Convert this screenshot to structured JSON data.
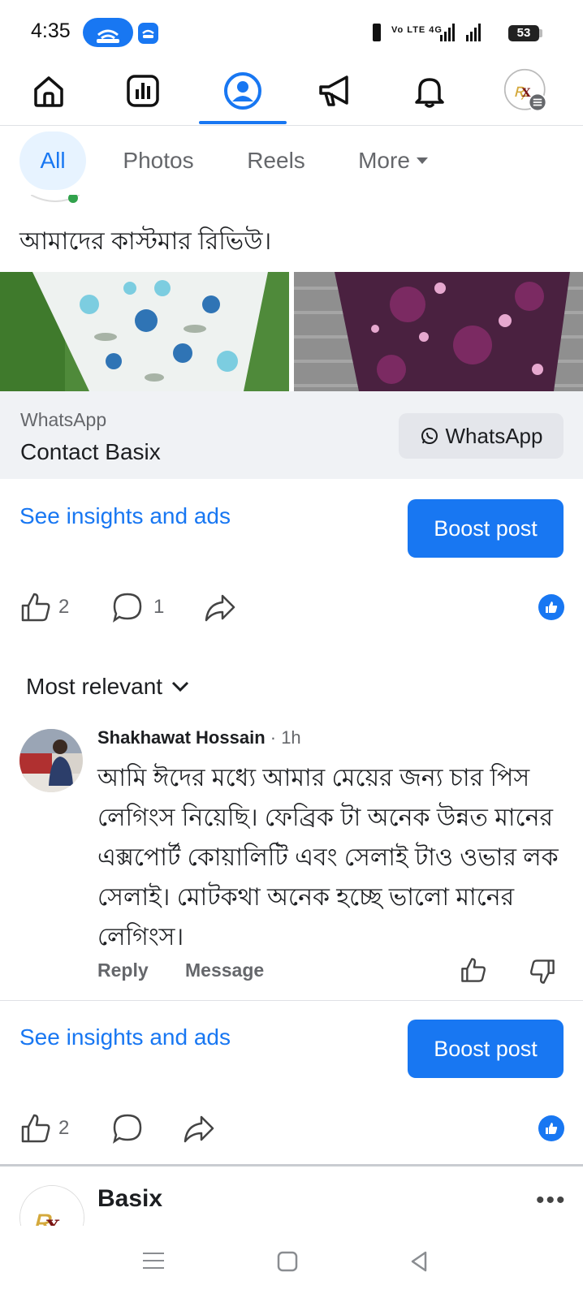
{
  "status_bar": {
    "time": "4:35",
    "network": "Vo LTE 4G",
    "battery": "53"
  },
  "nav": {
    "items": [
      {
        "icon": "home-icon"
      },
      {
        "icon": "insights-icon"
      },
      {
        "icon": "profile-icon",
        "active": true
      },
      {
        "icon": "megaphone-icon"
      },
      {
        "icon": "bell-icon"
      },
      {
        "icon": "page-avatar-icon"
      }
    ],
    "accent": "#1877f2"
  },
  "filters": {
    "all": "All",
    "photos": "Photos",
    "reels": "Reels",
    "more": "More"
  },
  "post1": {
    "caption": "আমাদের কাস্টমার রিভিউ।",
    "whatsapp_label": "WhatsApp",
    "whatsapp_cta_title": "Contact Basix",
    "whatsapp_button": "WhatsApp",
    "insights_link": "See insights and ads",
    "boost_button": "Boost post",
    "like_count": "2",
    "comment_count": "1"
  },
  "comments": {
    "sort_label": "Most relevant",
    "items": [
      {
        "author": "Shakhawat Hossain",
        "time": " · 1h",
        "text": "আমি ঈদের মধ্যে আমার মেয়ের জন্য চার পিস লেগিংস নিয়েছি। ফেব্রিক টা অনেক উন্নত মানের এক্সপোর্ট কোয়ালিটি এবং সেলাই টাও ওভার লক সেলাই। মোটকথা অনেক  হচ্ছে ভালো মানের লেগিংস।",
        "reply": "Reply",
        "message": "Message"
      }
    ]
  },
  "post2": {
    "insights_link": "See insights and ads",
    "boost_button": "Boost post",
    "like_count": "2"
  },
  "post3": {
    "page_name": "Basix"
  },
  "colors": {
    "primary": "#1877f2",
    "secondary_text": "#65676b",
    "chip_active_bg": "#e7f3ff",
    "wa_band_bg": "#f0f2f5"
  }
}
